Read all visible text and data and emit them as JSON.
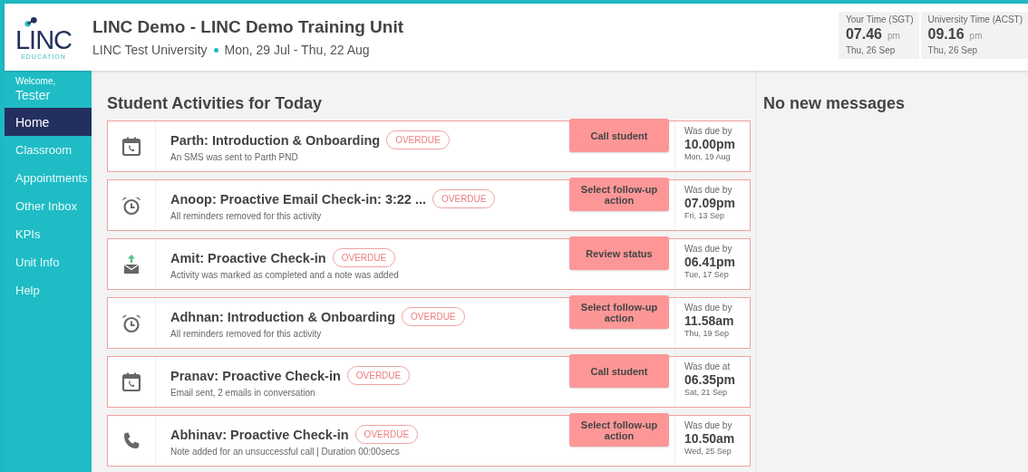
{
  "header": {
    "logo": {
      "word": "LINC",
      "tagline": "EDUCATION"
    },
    "title": "LINC Demo - LINC Demo Training Unit",
    "institution": "LINC Test University",
    "dates": "Mon, 29 Jul - Thu, 22 Aug",
    "clocks": [
      {
        "label": "Your Time (SGT)",
        "time": "07.46",
        "period": "pm",
        "date": "Thu, 26 Sep"
      },
      {
        "label": "University Time (ACST)",
        "time": "09.16",
        "period": "pm",
        "date": "Thu, 26 Sep"
      }
    ]
  },
  "sidebar": {
    "greeting": "Welcome,",
    "user": "Tester",
    "items": [
      {
        "label": "Home",
        "selected": true
      },
      {
        "label": "Classroom",
        "selected": false
      },
      {
        "label": "Appointments",
        "selected": false
      },
      {
        "label": "Other Inbox",
        "selected": false
      },
      {
        "label": "KPIs",
        "selected": false
      },
      {
        "label": "Unit Info",
        "selected": false
      },
      {
        "label": "Help",
        "selected": false
      }
    ]
  },
  "activities": {
    "heading": "Student Activities for Today",
    "items": [
      {
        "kind": "calendar",
        "title": "Parth: Introduction & Onboarding",
        "badge": "OVERDUE",
        "note": "An SMS was sent to Parth PND",
        "action": "Call student",
        "due_label": "Was due by",
        "due_time": "10.00pm",
        "due_date": "Mon, 19 Aug"
      },
      {
        "kind": "alarm",
        "title": "Anoop: Proactive Email Check-in: 3:22 ...",
        "badge": "OVERDUE",
        "note": "All reminders removed for this activity",
        "action": "Select follow-up action",
        "due_label": "Was due by",
        "due_time": "07.09pm",
        "due_date": "Fri, 13 Sep"
      },
      {
        "kind": "completed",
        "title": "Amit: Proactive Check-in",
        "badge": "OVERDUE",
        "note": "Activity was marked as completed and a note was added",
        "action": "Review status",
        "due_label": "Was due by",
        "due_time": "06.41pm",
        "due_date": "Tue, 17 Sep"
      },
      {
        "kind": "alarm",
        "title": "Adhnan: Introduction & Onboarding",
        "badge": "OVERDUE",
        "note": "All reminders removed for this activity",
        "action": "Select follow-up action",
        "due_label": "Was due by",
        "due_time": "11.58am",
        "due_date": "Thu, 19 Sep"
      },
      {
        "kind": "calendar",
        "title": "Pranav: Proactive Check-in",
        "badge": "OVERDUE",
        "note": "Email sent, 2 emails in conversation",
        "action": "Call student",
        "due_label": "Was due at",
        "due_time": "06.35pm",
        "due_date": "Sat, 21 Sep"
      },
      {
        "kind": "call",
        "title": "Abhinav: Proactive Check-in",
        "badge": "OVERDUE",
        "note": "Note added for an unsuccessful call | Duration 00:00secs",
        "action": "Select follow-up action",
        "due_label": "Was due by",
        "due_time": "10.50am",
        "due_date": "Wed, 25 Sep"
      }
    ]
  },
  "messages": {
    "heading": "No new messages"
  }
}
